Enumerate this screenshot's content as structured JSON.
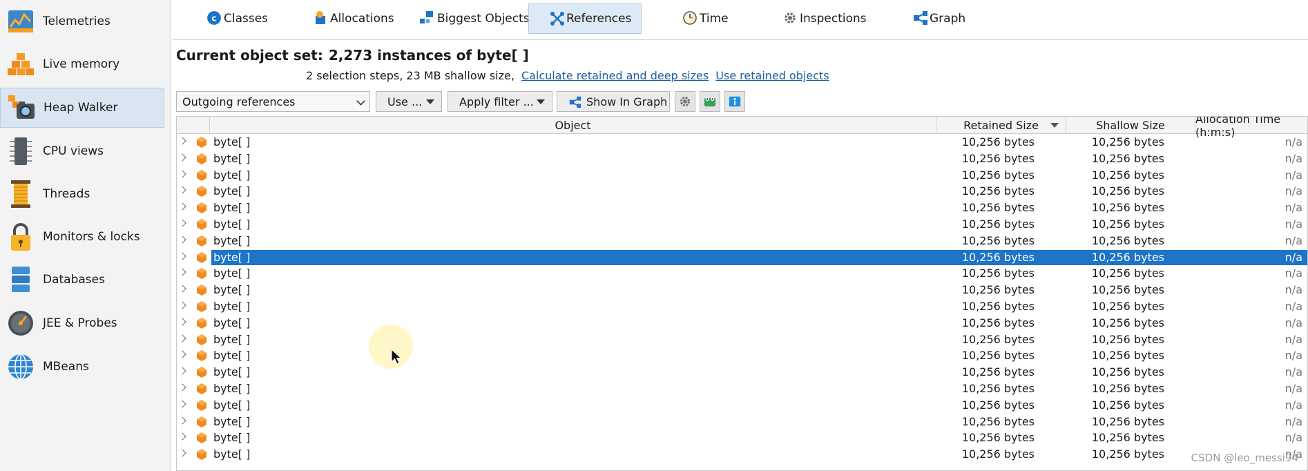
{
  "sidebar": {
    "items": [
      {
        "label": "Telemetries",
        "icon": "telemetries-icon"
      },
      {
        "label": "Live memory",
        "icon": "live-memory-icon"
      },
      {
        "label": "Heap Walker",
        "icon": "heap-walker-icon",
        "selected": true
      },
      {
        "label": "CPU views",
        "icon": "cpu-views-icon"
      },
      {
        "label": "Threads",
        "icon": "threads-icon"
      },
      {
        "label": "Monitors & locks",
        "icon": "lock-icon"
      },
      {
        "label": "Databases",
        "icon": "databases-icon"
      },
      {
        "label": "JEE & Probes",
        "icon": "probes-gauge-icon"
      },
      {
        "label": "MBeans",
        "icon": "mbeans-globe-icon"
      }
    ]
  },
  "tabs": [
    {
      "label": "Classes",
      "icon": "classes-icon"
    },
    {
      "label": "Allocations",
      "icon": "allocations-icon"
    },
    {
      "label": "Biggest Objects",
      "icon": "biggest-objects-icon"
    },
    {
      "label": "References",
      "icon": "references-icon",
      "active": true
    },
    {
      "label": "Time",
      "icon": "clock-icon"
    },
    {
      "label": "Inspections",
      "icon": "gear-icon"
    },
    {
      "label": "Graph",
      "icon": "graph-icon"
    }
  ],
  "header": {
    "title_label": "Current object set:",
    "title_value": "2,273 instances of byte[ ]",
    "steps_text": "2 selection steps, 23 MB shallow size,",
    "link_calculate": "Calculate retained and deep sizes",
    "link_use_retained": "Use retained objects"
  },
  "toolbar": {
    "view_select": "Outgoing references",
    "use_button": "Use ...",
    "filter_button": "Apply filter ...",
    "graph_button": "Show In Graph"
  },
  "table": {
    "columns": [
      "Object",
      "Retained Size",
      "Shallow Size",
      "Allocation Time (h:m:s)"
    ],
    "sorted_column": "Retained Size",
    "selected_row": 7,
    "rows": [
      {
        "object": "byte[ ]",
        "retained": "10,256 bytes",
        "shallow": "10,256 bytes",
        "alloc": "n/a"
      },
      {
        "object": "byte[ ]",
        "retained": "10,256 bytes",
        "shallow": "10,256 bytes",
        "alloc": "n/a"
      },
      {
        "object": "byte[ ]",
        "retained": "10,256 bytes",
        "shallow": "10,256 bytes",
        "alloc": "n/a"
      },
      {
        "object": "byte[ ]",
        "retained": "10,256 bytes",
        "shallow": "10,256 bytes",
        "alloc": "n/a"
      },
      {
        "object": "byte[ ]",
        "retained": "10,256 bytes",
        "shallow": "10,256 bytes",
        "alloc": "n/a"
      },
      {
        "object": "byte[ ]",
        "retained": "10,256 bytes",
        "shallow": "10,256 bytes",
        "alloc": "n/a"
      },
      {
        "object": "byte[ ]",
        "retained": "10,256 bytes",
        "shallow": "10,256 bytes",
        "alloc": "n/a"
      },
      {
        "object": "byte[ ]",
        "retained": "10,256 bytes",
        "shallow": "10,256 bytes",
        "alloc": "n/a"
      },
      {
        "object": "byte[ ]",
        "retained": "10,256 bytes",
        "shallow": "10,256 bytes",
        "alloc": "n/a"
      },
      {
        "object": "byte[ ]",
        "retained": "10,256 bytes",
        "shallow": "10,256 bytes",
        "alloc": "n/a"
      },
      {
        "object": "byte[ ]",
        "retained": "10,256 bytes",
        "shallow": "10,256 bytes",
        "alloc": "n/a"
      },
      {
        "object": "byte[ ]",
        "retained": "10,256 bytes",
        "shallow": "10,256 bytes",
        "alloc": "n/a"
      },
      {
        "object": "byte[ ]",
        "retained": "10,256 bytes",
        "shallow": "10,256 bytes",
        "alloc": "n/a"
      },
      {
        "object": "byte[ ]",
        "retained": "10,256 bytes",
        "shallow": "10,256 bytes",
        "alloc": "n/a"
      },
      {
        "object": "byte[ ]",
        "retained": "10,256 bytes",
        "shallow": "10,256 bytes",
        "alloc": "n/a"
      },
      {
        "object": "byte[ ]",
        "retained": "10,256 bytes",
        "shallow": "10,256 bytes",
        "alloc": "n/a"
      },
      {
        "object": "byte[ ]",
        "retained": "10,256 bytes",
        "shallow": "10,256 bytes",
        "alloc": "n/a"
      },
      {
        "object": "byte[ ]",
        "retained": "10,256 bytes",
        "shallow": "10,256 bytes",
        "alloc": "n/a"
      },
      {
        "object": "byte[ ]",
        "retained": "10,256 bytes",
        "shallow": "10,256 bytes",
        "alloc": "n/a"
      },
      {
        "object": "byte[ ]",
        "retained": "10,256 bytes",
        "shallow": "10,256 bytes",
        "alloc": "n/a"
      }
    ]
  },
  "credit": "CSDN @leo_messi94",
  "colors": {
    "selection": "#1e74c8",
    "link": "#1b5fa3",
    "object_icon": "#f08a1c"
  }
}
